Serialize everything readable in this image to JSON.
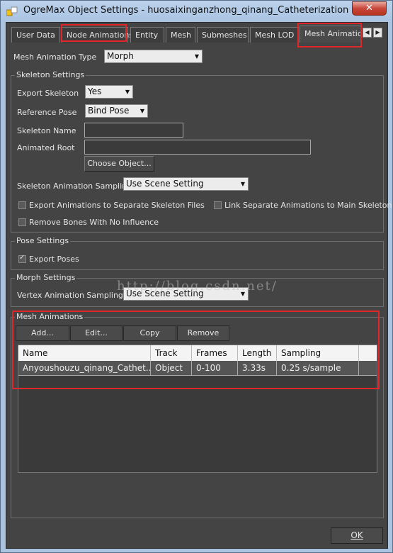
{
  "window": {
    "title": "OgreMax Object Settings - huosaixinganzhong_qinang_Catheterization",
    "close_symbol": "✕"
  },
  "tabs": [
    "User Data",
    "Node Animations",
    "Entity",
    "Mesh",
    "Submeshes",
    "Mesh LOD",
    "Mesh Animations"
  ],
  "tab_scroll": {
    "left": "◀",
    "right": "▶"
  },
  "mesh_animation_type": {
    "label": "Mesh Animation Type",
    "value": "Morph"
  },
  "skeleton_settings": {
    "title": "Skeleton Settings",
    "export_skeleton": {
      "label": "Export Skeleton",
      "value": "Yes"
    },
    "reference_pose": {
      "label": "Reference Pose",
      "value": "Bind Pose"
    },
    "skeleton_name": {
      "label": "Skeleton Name",
      "value": ""
    },
    "animated_root": {
      "label": "Animated Root",
      "value": ""
    },
    "choose_object": "Choose Object...",
    "sampling": {
      "label": "Skeleton Animation Sampling",
      "value": "Use Scene Setting"
    },
    "export_separate": {
      "label": "Export Animations to Separate Skeleton Files",
      "checked": false
    },
    "link_separate": {
      "label": "Link Separate Animations to Main Skeleton",
      "checked": false
    },
    "remove_bones": {
      "label": "Remove Bones With No Influence",
      "checked": false
    }
  },
  "pose_settings": {
    "title": "Pose Settings",
    "export_poses": {
      "label": "Export Poses",
      "checked": true
    }
  },
  "morph_settings": {
    "title": "Morph Settings",
    "vertex_sampling": {
      "label": "Vertex Animation Sampling",
      "value": "Use Scene Setting"
    }
  },
  "watermark": "http://blog.csdn.net/",
  "mesh_animations": {
    "title": "Mesh Animations",
    "buttons": {
      "add": "Add...",
      "edit": "Edit...",
      "copy": "Copy",
      "remove": "Remove"
    },
    "columns": [
      "Name",
      "Track",
      "Frames",
      "Length",
      "Sampling"
    ],
    "rows": [
      {
        "name": "Anyoushouzu_qinang_Cathet...",
        "track": "Object",
        "frames": "0-100",
        "length": "3.33s",
        "sampling": "0.25 s/sample"
      }
    ]
  },
  "ok_button": "OK",
  "colors": {
    "highlight": "#e1262a",
    "panel": "#444444",
    "titlebar": "#a9c3e1"
  }
}
